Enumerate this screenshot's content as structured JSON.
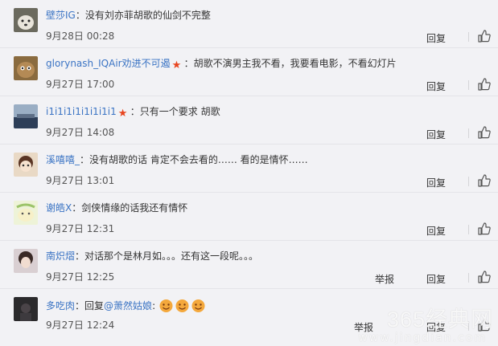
{
  "actions": {
    "reply": "回复",
    "report": "举报",
    "report_short": "举报"
  },
  "comments": [
    {
      "user": "壁莎IG",
      "text": "没有刘亦菲胡歌的仙剑不完整",
      "time": "9月28日 00:28"
    },
    {
      "user": "glorynash_IQAir劝进不可遏",
      "text": "胡歌不演男主我不看，我要看电影，不看幻灯片",
      "time": "9月27日 17:00"
    },
    {
      "user": "i1i1i1i1i1i1i1i1",
      "text": "只有一个要求 胡歌",
      "time": "9月27日 14:08"
    },
    {
      "user": "溪嘻嘻_",
      "text": "没有胡歌的话 肯定不会去看的…… 看的是情怀……",
      "time": "9月27日 13:01"
    },
    {
      "user": "谢皓X",
      "text": "剑侠情缘的话我还有情怀",
      "time": "9月27日 12:31"
    },
    {
      "user": "南炽熠",
      "text": "对话那个是林月如。。。还有这一段呢。。。",
      "time": "9月27日 12:25"
    },
    {
      "user": "多吃肉",
      "text_prefix": "回复",
      "mention": "@萧然姑娘",
      "text_suffix": ":",
      "time": "9月27日 12:24"
    }
  ],
  "watermark": {
    "text": "365经典网",
    "url": "www.jingdian.com"
  },
  "colors": {
    "link": "#3b74c4",
    "vip_star": "#e8441e",
    "background": "#f2f2f5"
  }
}
